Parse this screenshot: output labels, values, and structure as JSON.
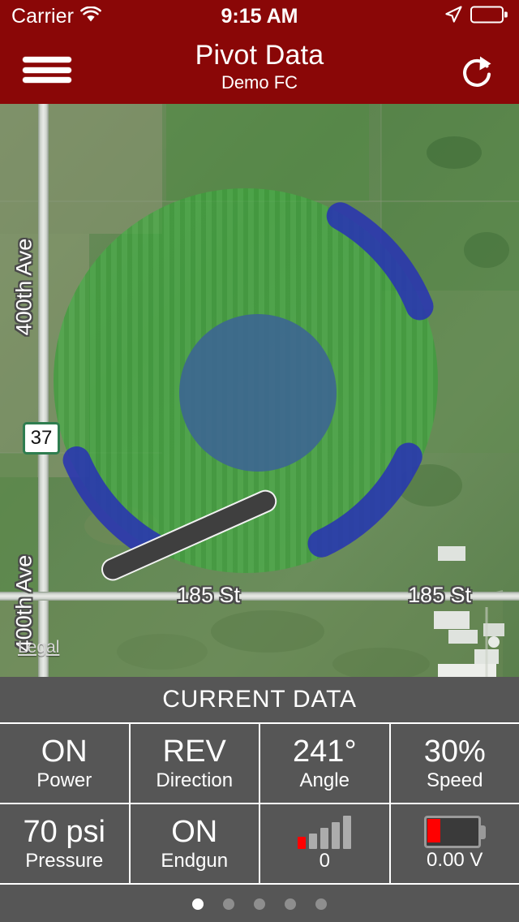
{
  "status_bar": {
    "carrier": "Carrier",
    "wifi_icon": "wifi-icon",
    "time": "9:15 AM",
    "location_icon": "location-arrow-icon",
    "battery_icon": "battery-icon"
  },
  "nav_bar": {
    "menu_icon": "hamburger-menu-icon",
    "title": "Pivot Data",
    "subtitle": "Demo FC",
    "refresh_icon": "refresh-icon",
    "background_color": "#8A0707"
  },
  "map": {
    "labels": {
      "avenue_top": "400th Ave",
      "avenue_bottom": "400th Ave",
      "street_left": "185 St",
      "street_right": "185 St",
      "highway_shield": "37",
      "legal": "Legal"
    },
    "field_color": "#3FAA3F",
    "inner_circle_color": "#3C6494",
    "arc_color": "#2832B4",
    "arm_color": "#3F3F3F"
  },
  "panel": {
    "header": "CURRENT DATA",
    "rows": [
      [
        {
          "value": "ON",
          "label": "Power",
          "type": "text"
        },
        {
          "value": "REV",
          "label": "Direction",
          "type": "text"
        },
        {
          "value": "241°",
          "label": "Angle",
          "type": "text"
        },
        {
          "value": "30%",
          "label": "Speed",
          "type": "text"
        }
      ],
      [
        {
          "value": "70 psi",
          "label": "Pressure",
          "type": "text"
        },
        {
          "value": "ON",
          "label": "Endgun",
          "type": "text"
        },
        {
          "value": "",
          "label": "0",
          "type": "signal",
          "icon": "signal-bars-icon"
        },
        {
          "value": "",
          "label": "0.00 V",
          "type": "battery",
          "icon": "battery-level-icon"
        }
      ]
    ],
    "background_color": "#565656"
  },
  "pager": {
    "total": 5,
    "active_index": 0
  }
}
